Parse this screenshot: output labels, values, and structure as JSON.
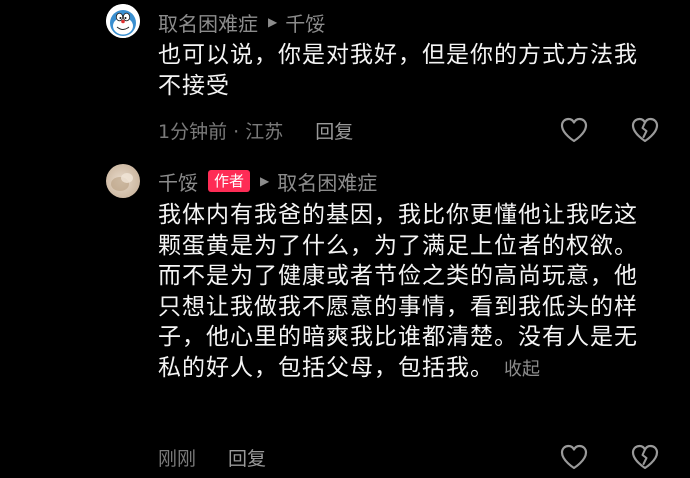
{
  "comments": [
    {
      "username": "取名困难症",
      "reply_to": "千馁",
      "text": "也可以说，你是对我好，但是你的方式方法我不接受",
      "time_location": "1分钟前 · 江苏",
      "reply_label": "回复"
    },
    {
      "username": "千馁",
      "badge": "作者",
      "reply_to": "取名困难症",
      "text": "我体内有我爸的基因，我比你更懂他让我吃这颗蛋黄是为了什么，为了满足上位者的权欲。而不是为了健康或者节俭之类的高尚玩意，他只想让我做我不愿意的事情，看到我低头的样子，他心里的暗爽我比谁都清楚。没有人是无私的好人，包括父母，包括我。",
      "collapse_label": "收起",
      "time_location": "刚刚",
      "reply_label": "回复"
    }
  ],
  "icons": {
    "reply_arrow": "▶",
    "like": "heart-outline-icon",
    "dislike": "broken-heart-icon"
  },
  "colors": {
    "background": "#000000",
    "primary_text": "#f4f4f4",
    "secondary_text": "#8c8c8c",
    "author_badge": "#fe2c55"
  }
}
